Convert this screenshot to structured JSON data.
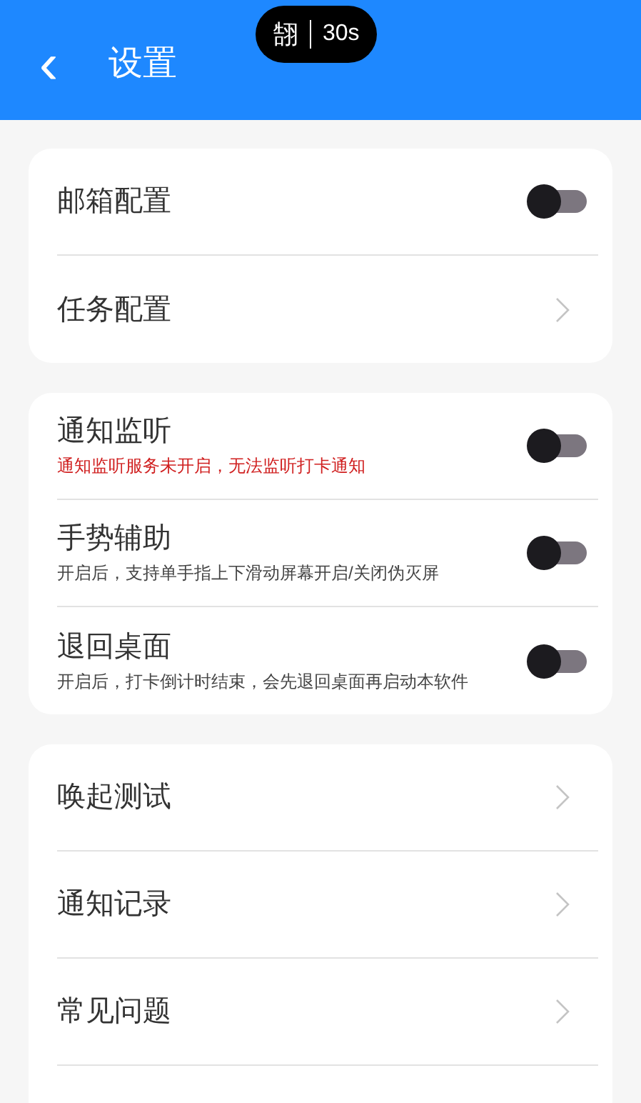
{
  "header": {
    "back": "‹",
    "title": "设置"
  },
  "timer_pill": {
    "icon_text": "䎋",
    "time": "30s"
  },
  "sections": [
    {
      "items": [
        {
          "kind": "toggle",
          "label": "邮箱配置",
          "on": false
        },
        {
          "kind": "link",
          "label": "任务配置"
        }
      ]
    },
    {
      "items": [
        {
          "kind": "toggle",
          "label": "通知监听",
          "on": false,
          "note": "通知监听服务未开启，无法监听打卡通知",
          "warning": true
        },
        {
          "kind": "toggle",
          "label": "手势辅助",
          "on": false,
          "note": "开启后，支持单手指上下滑动屏幕开启/关闭伪灭屏",
          "warning": false
        },
        {
          "kind": "toggle",
          "label": "退回桌面",
          "on": false,
          "note": "开启后，打卡倒计时结束，会先退回桌面再启动本软件",
          "warning": false
        }
      ]
    },
    {
      "items": [
        {
          "kind": "link",
          "label": "唤起测试"
        },
        {
          "kind": "link",
          "label": "通知记录"
        },
        {
          "kind": "link",
          "label": "常见问题"
        }
      ]
    }
  ]
}
